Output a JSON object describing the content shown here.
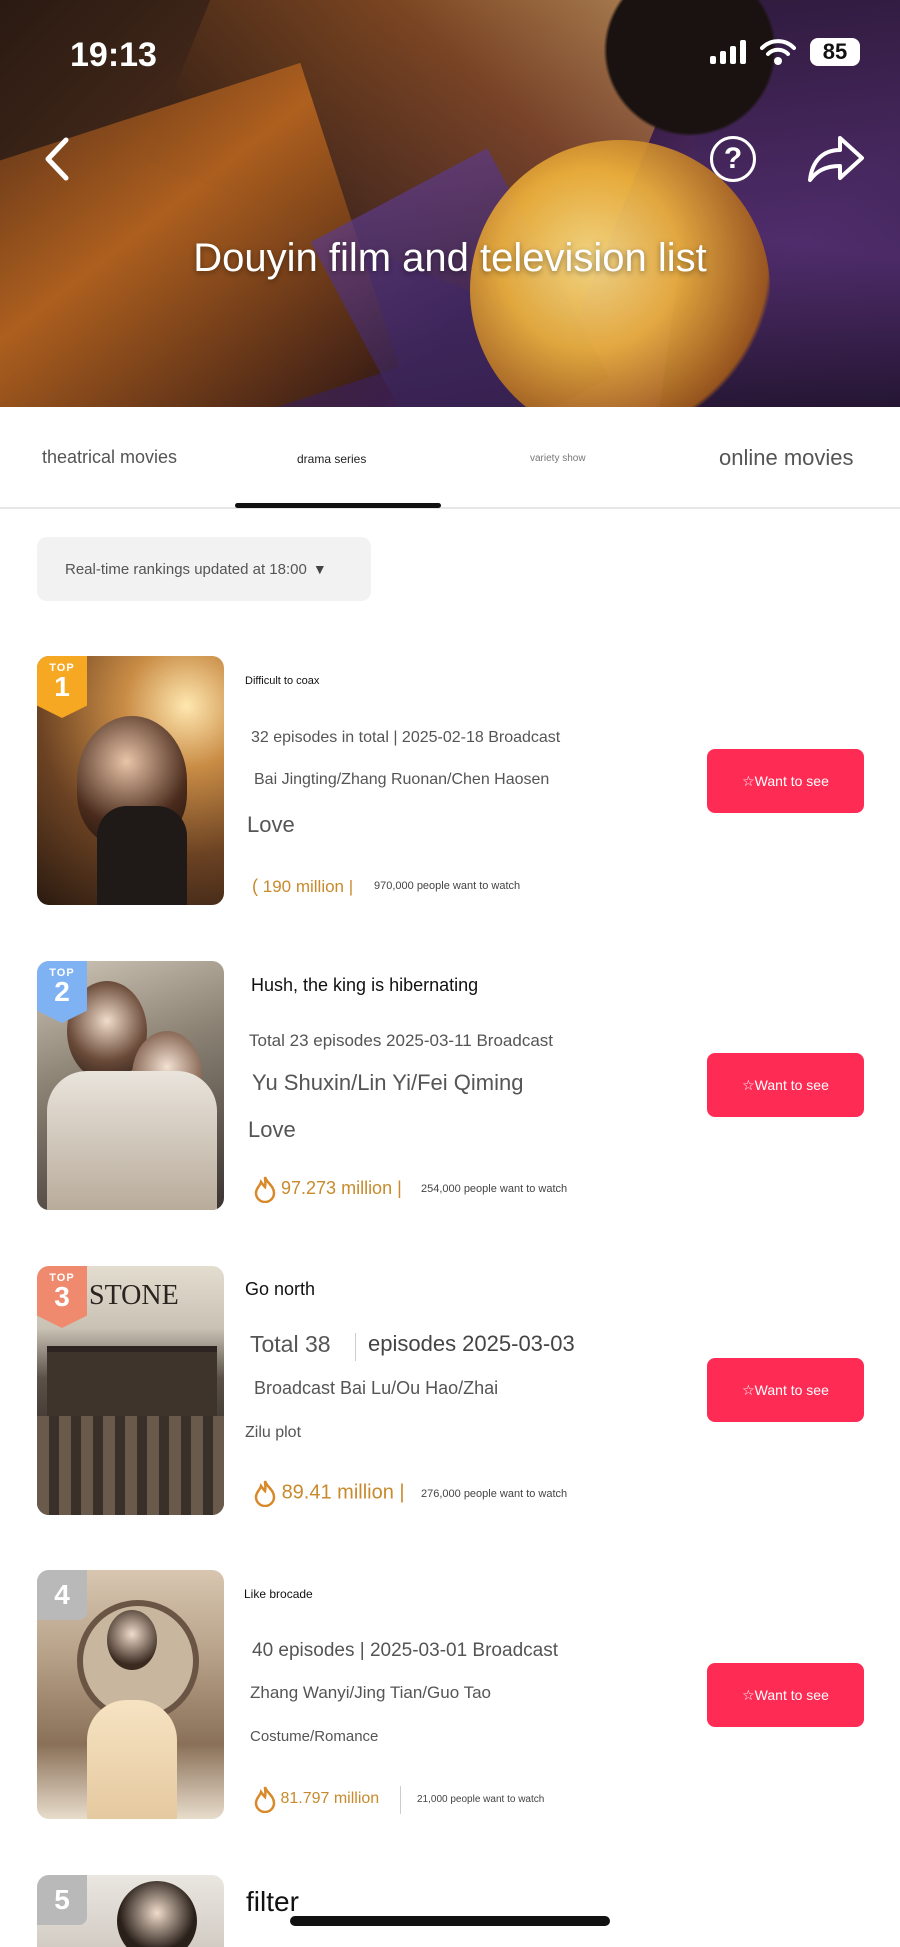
{
  "status_bar": {
    "time": "19:13",
    "battery": "85"
  },
  "header": {
    "title": "Douyin film and television list"
  },
  "tabs": [
    {
      "label": "theatrical movies"
    },
    {
      "label": "drama series"
    },
    {
      "label": "variety show"
    },
    {
      "label": "online movies"
    }
  ],
  "update_chip": {
    "label": "Real-time rankings updated at 18:00",
    "caret": "▼"
  },
  "badge_top": "TOP",
  "items": [
    {
      "rank": "1",
      "title": "Difficult to coax",
      "line1": "32 episodes in total | 2025-02-18 Broadcast",
      "line2": "Bai Jingting/Zhang Ruonan/Chen Haosen",
      "line3": "Love",
      "heat": "190 million |",
      "want_count": "970,000 people want to watch",
      "button": "☆Want to see"
    },
    {
      "rank": "2",
      "title": "Hush, the king is hibernating",
      "line1": "Total 23 episodes 2025-03-11 Broadcast",
      "line2": "Yu Shuxin/Lin Yi/Fei Qiming",
      "line3": "Love",
      "heat": "97.273 million |",
      "want_count": "254,000 people want to watch",
      "button": "☆Want to see"
    },
    {
      "rank": "3",
      "title": "Go north",
      "poster_text": "STONE",
      "line1a": "Total 38",
      "line1b": "episodes 2025-03-03",
      "line2": "Broadcast Bai Lu/Ou Hao/Zhai",
      "line3": "Zilu plot",
      "heat": "89.41 million |",
      "want_count": "276,000 people want to watch",
      "button": "☆Want to see"
    },
    {
      "rank": "4",
      "title": "Like brocade",
      "line1": "40 episodes | 2025-03-01 Broadcast",
      "line2": "Zhang Wanyi/Jing Tian/Guo Tao",
      "line3": "Costume/Romance",
      "heat": "81.797 million",
      "want_count": "21,000 people want to watch",
      "button": "☆Want to see"
    },
    {
      "rank": "5",
      "title": "filter"
    }
  ],
  "colors": {
    "accent": "#fe2c55",
    "heat": "#c88a2c"
  }
}
